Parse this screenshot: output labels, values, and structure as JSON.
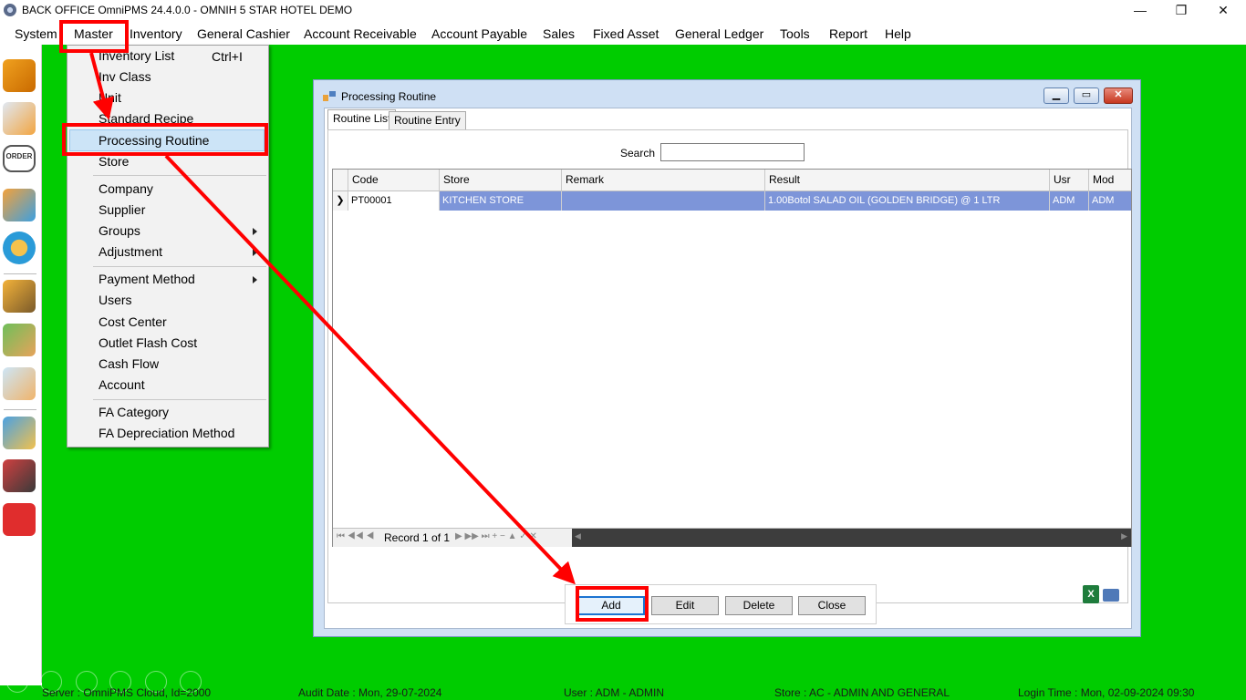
{
  "window": {
    "title": "BACK OFFICE OmniPMS 24.4.0.0 - OMNIH 5 STAR HOTEL DEMO",
    "minimize": "—",
    "restore": "❐",
    "close": "✕"
  },
  "menubar": [
    "System",
    "Master",
    "Inventory",
    "General Cashier",
    "Account Receivable",
    "Account Payable",
    "Sales",
    "Fixed Asset",
    "General Ledger",
    "Tools",
    "Report",
    "Help"
  ],
  "master_menu": {
    "items": [
      {
        "label": "Inventory List",
        "shortcut": "Ctrl+I"
      },
      {
        "label": "Inv Class"
      },
      {
        "label": "Unit"
      },
      {
        "label": "Standard Recipe"
      },
      {
        "label": "Processing Routine",
        "selected": true
      },
      {
        "label": "Store"
      },
      {
        "label": "Company"
      },
      {
        "label": "Supplier"
      },
      {
        "label": "Groups",
        "submenu": true
      },
      {
        "label": "Adjustment",
        "submenu": true
      },
      {
        "label": "Payment Method",
        "submenu": true
      },
      {
        "label": "Users"
      },
      {
        "label": "Cost Center"
      },
      {
        "label": "Outlet Flash Cost"
      },
      {
        "label": "Cash Flow"
      },
      {
        "label": "Account"
      },
      {
        "label": "FA Category"
      },
      {
        "label": "FA Depreciation Method"
      }
    ]
  },
  "toolbar_icons": [
    "inventory-boxes-icon",
    "checklist-clipboard-icon",
    "order-icon",
    "shopping-cart-icon",
    "exchange-cycle-icon",
    "money-bag-icon",
    "hand-money-icon",
    "mobile-touch-icon",
    "ledger-book-icon",
    "report-chart-icon",
    "exit-icon"
  ],
  "dialog": {
    "title": "Processing Routine",
    "tabs": [
      "Routine List",
      "Routine Entry"
    ],
    "active_tab": "Routine List",
    "search_label": "Search",
    "search_value": "",
    "columns": [
      "Code",
      "Store",
      "Remark",
      "Result",
      "Usr",
      "Mod"
    ],
    "rows": [
      {
        "indicator": "❯",
        "code": "PT00001",
        "store": "KITCHEN STORE",
        "remark": "",
        "result": "1.00Botol SALAD OIL (GOLDEN BRIDGE) @ 1 LTR",
        "usr": "ADM",
        "mod": "ADM"
      }
    ],
    "navigator": {
      "first_prev": "⏮ ◀◀ ◀",
      "record_text": "Record 1 of 1",
      "next_last": "▶ ▶▶ ⏭ + − ▲ ✓ ✕",
      "scroll_left": "◀",
      "scroll_right": "▶"
    },
    "buttons": {
      "add": "Add",
      "edit": "Edit",
      "delete": "Delete",
      "close": "Close"
    },
    "excel_label": "X"
  },
  "statusbar": {
    "server": "Server : OmniPMS Cloud, Id=2000",
    "audit_date": "Audit Date : Mon, 29-07-2024",
    "user": "User : ADM - ADMIN",
    "store": "Store : AC - ADMIN AND GENERAL",
    "login_time": "Login Time : Mon, 02-09-2024 09:30"
  },
  "colors": {
    "desktop_green": "#00cc00",
    "annotation_red": "#ff0000",
    "selection_blue": "#7d95d9",
    "menu_highlight": "#cce4f7"
  }
}
